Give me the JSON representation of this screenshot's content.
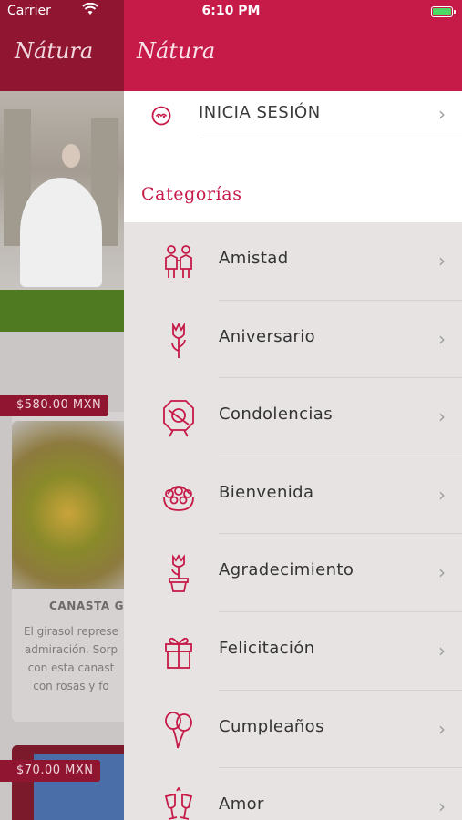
{
  "status_bar": {
    "carrier": "Carrier",
    "time": "6:10 PM"
  },
  "background": {
    "logo": "Nátura",
    "card1": {
      "price": "$580.00 MXN",
      "title": "CANASTA GI",
      "description_lines": [
        "El girasol represe",
        "admiración. Sorp",
        "con esta canast",
        "con rosas y fo"
      ]
    },
    "card2": {
      "price": "$70.00 MXN"
    }
  },
  "drawer": {
    "logo": "Nátura",
    "login_label": "INICIA SESIÓN",
    "section_title": "Categorías",
    "categories": [
      {
        "label": "Amistad",
        "icon": "friends-icon"
      },
      {
        "label": "Aniversario",
        "icon": "tulip-icon"
      },
      {
        "label": "Condolencias",
        "icon": "wreath-icon"
      },
      {
        "label": "Bienvenida",
        "icon": "flower-basket-icon"
      },
      {
        "label": "Agradecimiento",
        "icon": "potted-flower-icon"
      },
      {
        "label": "Felicitación",
        "icon": "gift-icon"
      },
      {
        "label": "Cumpleaños",
        "icon": "balloons-icon"
      },
      {
        "label": "Amor",
        "icon": "champagne-glasses-icon"
      }
    ]
  },
  "colors": {
    "brand": "#c61a48",
    "brand_dark": "#8f1531",
    "drawer_bg": "#e6e3e2"
  }
}
